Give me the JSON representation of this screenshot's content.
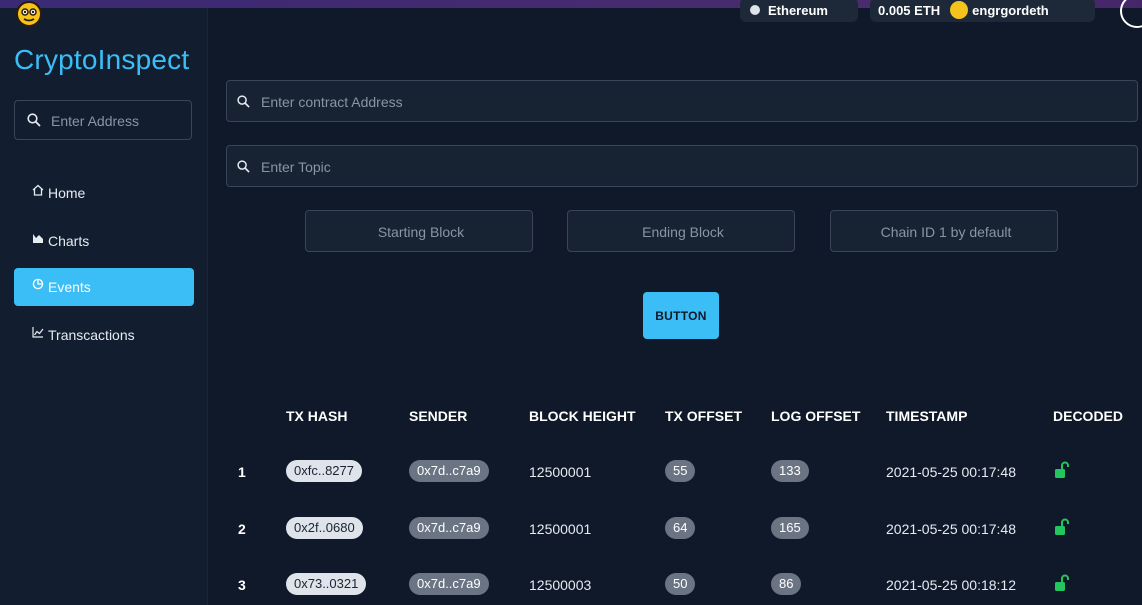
{
  "brand": {
    "name": "CryptoInspect"
  },
  "topbar": {
    "network_label": "Ethereum",
    "balance_label": "0.005 ETH",
    "account_label": "engrgordeth"
  },
  "sidebar": {
    "search_placeholder": "Enter Address",
    "items": [
      {
        "label": "Home",
        "icon": "home-icon"
      },
      {
        "label": "Charts",
        "icon": "chart-icon"
      },
      {
        "label": "Events",
        "icon": "events-icon",
        "active": true
      },
      {
        "label": "Transcactions",
        "icon": "line-chart-icon"
      }
    ]
  },
  "form": {
    "contract_placeholder": "Enter contract Address",
    "topic_placeholder": "Enter Topic",
    "starting_block_placeholder": "Starting Block",
    "ending_block_placeholder": "Ending Block",
    "chain_id_placeholder": "Chain ID 1 by default",
    "button_label": "BUTTON"
  },
  "table": {
    "headers": [
      "TX HASH",
      "SENDER",
      "BLOCK HEIGHT",
      "TX OFFSET",
      "LOG OFFSET",
      "TIMESTAMP",
      "DECODED"
    ],
    "rows": [
      {
        "index": "1",
        "tx_hash": "0xfc..8277",
        "sender": "0x7d..c7a9",
        "block_height": "12500001",
        "tx_offset": "55",
        "log_offset": "133",
        "timestamp": "2021-05-25 00:17:48",
        "decoded": "unlocked"
      },
      {
        "index": "2",
        "tx_hash": "0x2f..0680",
        "sender": "0x7d..c7a9",
        "block_height": "12500001",
        "tx_offset": "64",
        "log_offset": "165",
        "timestamp": "2021-05-25 00:17:48",
        "decoded": "unlocked"
      },
      {
        "index": "3",
        "tx_hash": "0x73..0321",
        "sender": "0x7d..c7a9",
        "block_height": "12500003",
        "tx_offset": "50",
        "log_offset": "86",
        "timestamp": "2021-05-25 00:18:12",
        "decoded": "unlocked"
      }
    ]
  },
  "colors": {
    "accent": "#3bbdf5",
    "background": "#0f1929",
    "sidebar": "#121e2f",
    "unlocked": "#22c55e"
  }
}
